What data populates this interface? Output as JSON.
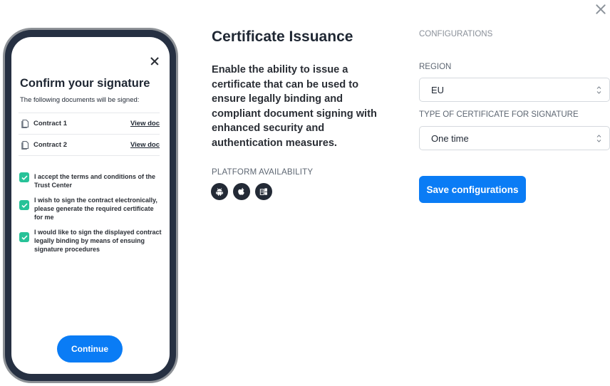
{
  "modal": {
    "close_icon": "close-icon"
  },
  "phone": {
    "close_icon": "close-icon",
    "title": "Confirm your signature",
    "subtitle": "The following documents will be signed:",
    "documents": [
      {
        "name": "Contract 1",
        "action": "View doc",
        "icon": "document-icon"
      },
      {
        "name": "Contract 2",
        "action": "View doc",
        "icon": "document-icon"
      }
    ],
    "checkboxes": [
      {
        "label": "I accept the terms and conditions of the Trust Center",
        "checked": true
      },
      {
        "label": "I wish to sign the contract electronically, please generate the required certificate for me",
        "checked": true
      },
      {
        "label": "I would like to sign the displayed contract legally binding by means of ensuing signature procedures",
        "checked": true
      }
    ],
    "continue_label": "Continue"
  },
  "feature": {
    "title": "Certificate Issuance",
    "description": "Enable the ability to issue a certificate that can be used to ensure legally binding and compliant document signing with enhanced security and authentication measures.",
    "platform_label": "PLATFORM AVAILABILITY",
    "platforms": [
      "android-icon",
      "apple-icon",
      "windows-icon"
    ]
  },
  "configurations": {
    "heading": "CONFIGURATIONS",
    "region": {
      "label": "REGION",
      "value": "EU"
    },
    "certificate_type": {
      "label": "TYPE OF CERTIFICATE FOR SIGNATURE",
      "value": "One time"
    },
    "save_label": "Save configurations"
  },
  "colors": {
    "primary": "#0a7cf5",
    "check": "#27c298",
    "phone_bezel": "#263042",
    "text": "#1f2733"
  }
}
